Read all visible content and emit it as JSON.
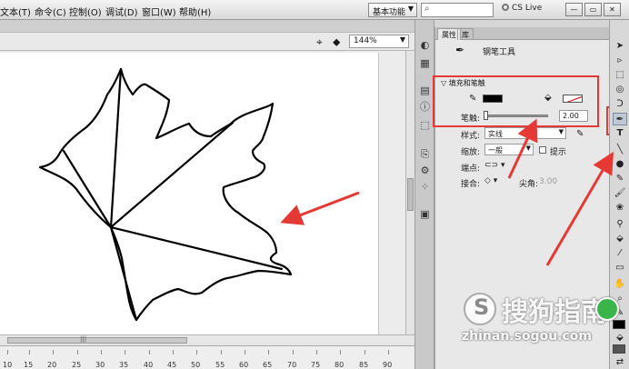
{
  "menu": [
    "文本(T)",
    "命令(C)",
    "控制(O)",
    "调试(D)",
    "窗口(W)",
    "帮助(H)"
  ],
  "topbar": {
    "workspace": "基本功能",
    "cslive": "CS Live"
  },
  "window_controls": [
    "—",
    "▭",
    "✕"
  ],
  "stage": {
    "zoom": "144%"
  },
  "ruler": [
    "10",
    "15",
    "20",
    "25",
    "30",
    "35",
    "40",
    "45",
    "50",
    "55",
    "60",
    "65",
    "70",
    "75",
    "80",
    "85",
    "90"
  ],
  "props": {
    "tabs": [
      "属性",
      "库"
    ],
    "tool_name": "钢笔工具",
    "section_fill_stroke": "填充和笔触",
    "stroke_label": "笔触:",
    "stroke_value": "2.00",
    "style_label": "样式:",
    "style_value": "实线",
    "scale_label": "缩放:",
    "scale_value": "一般",
    "hint_label": "提示",
    "cap_label": "端点:",
    "join_label": "接合:",
    "miter_label": "尖角:",
    "miter_value": "3.00"
  },
  "colors": {
    "stroke": "#000000",
    "highlight": "#e53935"
  },
  "watermark": {
    "brand": "搜狗指南",
    "logo_letter": "S",
    "url": "zhinan.sogou.com"
  }
}
